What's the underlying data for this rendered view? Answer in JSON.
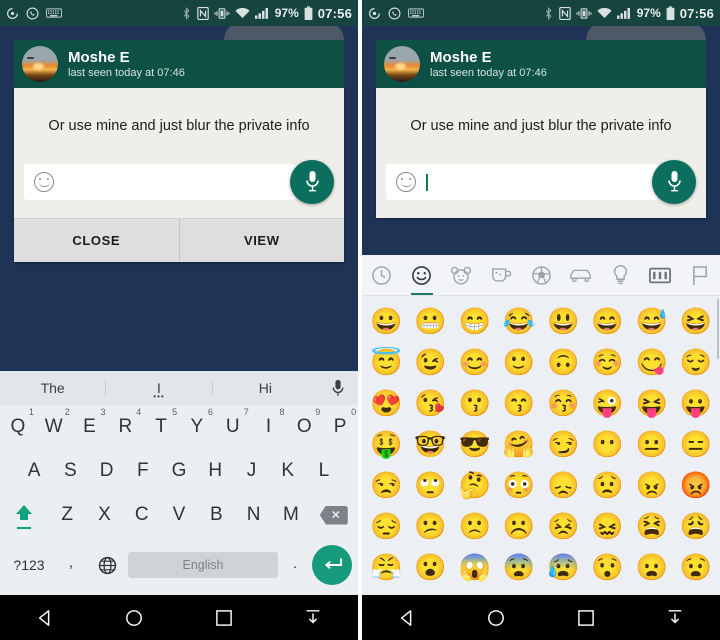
{
  "status_bar": {
    "left_icons": [
      "podcast-icon",
      "whatsapp-call-icon",
      "keyboard-icon"
    ],
    "right_icons": [
      "bluetooth-icon",
      "nfc-icon",
      "vibrate-icon",
      "wifi-icon",
      "signal-icon"
    ],
    "battery_percent": "97%",
    "time": "07:56"
  },
  "chat_header": {
    "contact_name": "Moshe E",
    "status": "last seen today at 07:46"
  },
  "dialog": {
    "message": "Or use mine and just blur the private info",
    "input_value": "",
    "close_label": "CLOSE",
    "view_label": "VIEW"
  },
  "keyboard": {
    "suggestions": [
      "The",
      "I",
      "Hi"
    ],
    "row1": [
      {
        "letter": "Q",
        "num": "1"
      },
      {
        "letter": "W",
        "num": "2"
      },
      {
        "letter": "E",
        "num": "3"
      },
      {
        "letter": "R",
        "num": "4"
      },
      {
        "letter": "T",
        "num": "5"
      },
      {
        "letter": "Y",
        "num": "6"
      },
      {
        "letter": "U",
        "num": "7"
      },
      {
        "letter": "I",
        "num": "8"
      },
      {
        "letter": "O",
        "num": "9"
      },
      {
        "letter": "P",
        "num": "0"
      }
    ],
    "row2": [
      "A",
      "S",
      "D",
      "F",
      "G",
      "H",
      "J",
      "K",
      "L"
    ],
    "row3": [
      "Z",
      "X",
      "C",
      "V",
      "B",
      "N",
      "M"
    ],
    "symbols_label": "?123",
    "comma_label": ",",
    "space_label": "English",
    "period_label": ".",
    "globe_icon": "globe-icon",
    "shift_icon": "shift-icon",
    "backspace_icon": "backspace-icon",
    "enter_icon": "enter-icon"
  },
  "emoji_panel": {
    "tabs": [
      {
        "name": "recent",
        "icon": "clock-icon",
        "active": false
      },
      {
        "name": "smileys",
        "icon": "smiley-icon",
        "active": true
      },
      {
        "name": "animals",
        "icon": "animal-icon",
        "active": false
      },
      {
        "name": "food",
        "icon": "cup-icon",
        "active": false
      },
      {
        "name": "sports",
        "icon": "soccer-ball-icon",
        "active": false
      },
      {
        "name": "travel",
        "icon": "car-icon",
        "active": false
      },
      {
        "name": "objects",
        "icon": "lightbulb-icon",
        "active": false
      },
      {
        "name": "symbols",
        "icon": "symbols-icon",
        "active": false
      },
      {
        "name": "flags",
        "icon": "flag-icon",
        "active": false
      }
    ],
    "rows": [
      [
        "😀",
        "😬",
        "😁",
        "😂",
        "😃",
        "😄",
        "😅",
        "😆"
      ],
      [
        "😇",
        "😉",
        "😊",
        "🙂",
        "🙃",
        "☺️",
        "😋",
        "😌"
      ],
      [
        "😍",
        "😘",
        "😗",
        "😙",
        "😚",
        "😜",
        "😝",
        "😛"
      ],
      [
        "🤑",
        "🤓",
        "😎",
        "🤗",
        "😏",
        "😶",
        "😐",
        "😑"
      ],
      [
        "😒",
        "🙄",
        "🤔",
        "😳",
        "😞",
        "😟",
        "😠",
        "😡"
      ],
      [
        "😔",
        "😕",
        "🙁",
        "☹️",
        "😣",
        "😖",
        "😫",
        "😩"
      ],
      [
        "😤",
        "😮",
        "😱",
        "😨",
        "😰",
        "😯",
        "😦",
        "😧"
      ]
    ]
  },
  "nav_bar": {
    "back_icon": "back-triangle-icon",
    "home_icon": "home-circle-icon",
    "recents_icon": "recents-square-icon",
    "hide_keyboard_icon": "hide-keyboard-icon"
  },
  "colors": {
    "status_bar": "#17443f",
    "chat_header": "#0d5045",
    "accent_green": "#0c6e5c",
    "wallpaper": "#1e3356",
    "dialog_bg": "#efeee8",
    "keyboard_bg": "#eceff1",
    "emoji_bg": "#eceff4"
  }
}
